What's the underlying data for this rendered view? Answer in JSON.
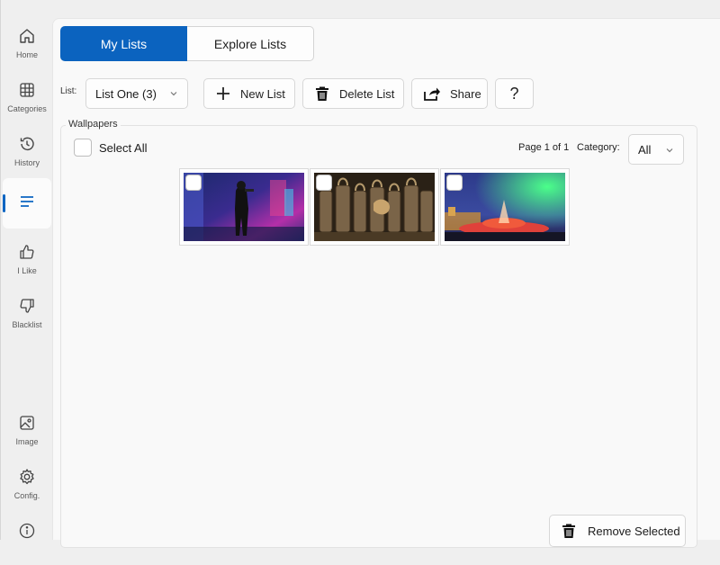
{
  "sidebar": {
    "items": [
      {
        "label": "Home",
        "icon": "home-icon"
      },
      {
        "label": "Categories",
        "icon": "grid-icon"
      },
      {
        "label": "History",
        "icon": "history-icon"
      },
      {
        "label": "",
        "icon": "list-icon",
        "active": true
      },
      {
        "label": "I Like",
        "icon": "thumbs-up-icon"
      },
      {
        "label": "Blacklist",
        "icon": "thumbs-down-icon"
      },
      {
        "label": "Image",
        "icon": "image-icon"
      },
      {
        "label": "Config.",
        "icon": "gear-icon"
      },
      {
        "label": "",
        "icon": "info-icon"
      }
    ]
  },
  "tabs": {
    "my_lists": "My Lists",
    "explore_lists": "Explore Lists"
  },
  "toolbar": {
    "list_label": "List:",
    "list_value": "List One (3)",
    "new_list": "New List",
    "delete_list": "Delete List",
    "share": "Share",
    "help": "?"
  },
  "wallpapers": {
    "title": "Wallpapers",
    "select_all": "Select All",
    "page_info": "Page 1 of 1",
    "category_label": "Category:",
    "category_value": "All",
    "remove_selected": "Remove Selected"
  },
  "colors": {
    "accent": "#0b63bf"
  }
}
